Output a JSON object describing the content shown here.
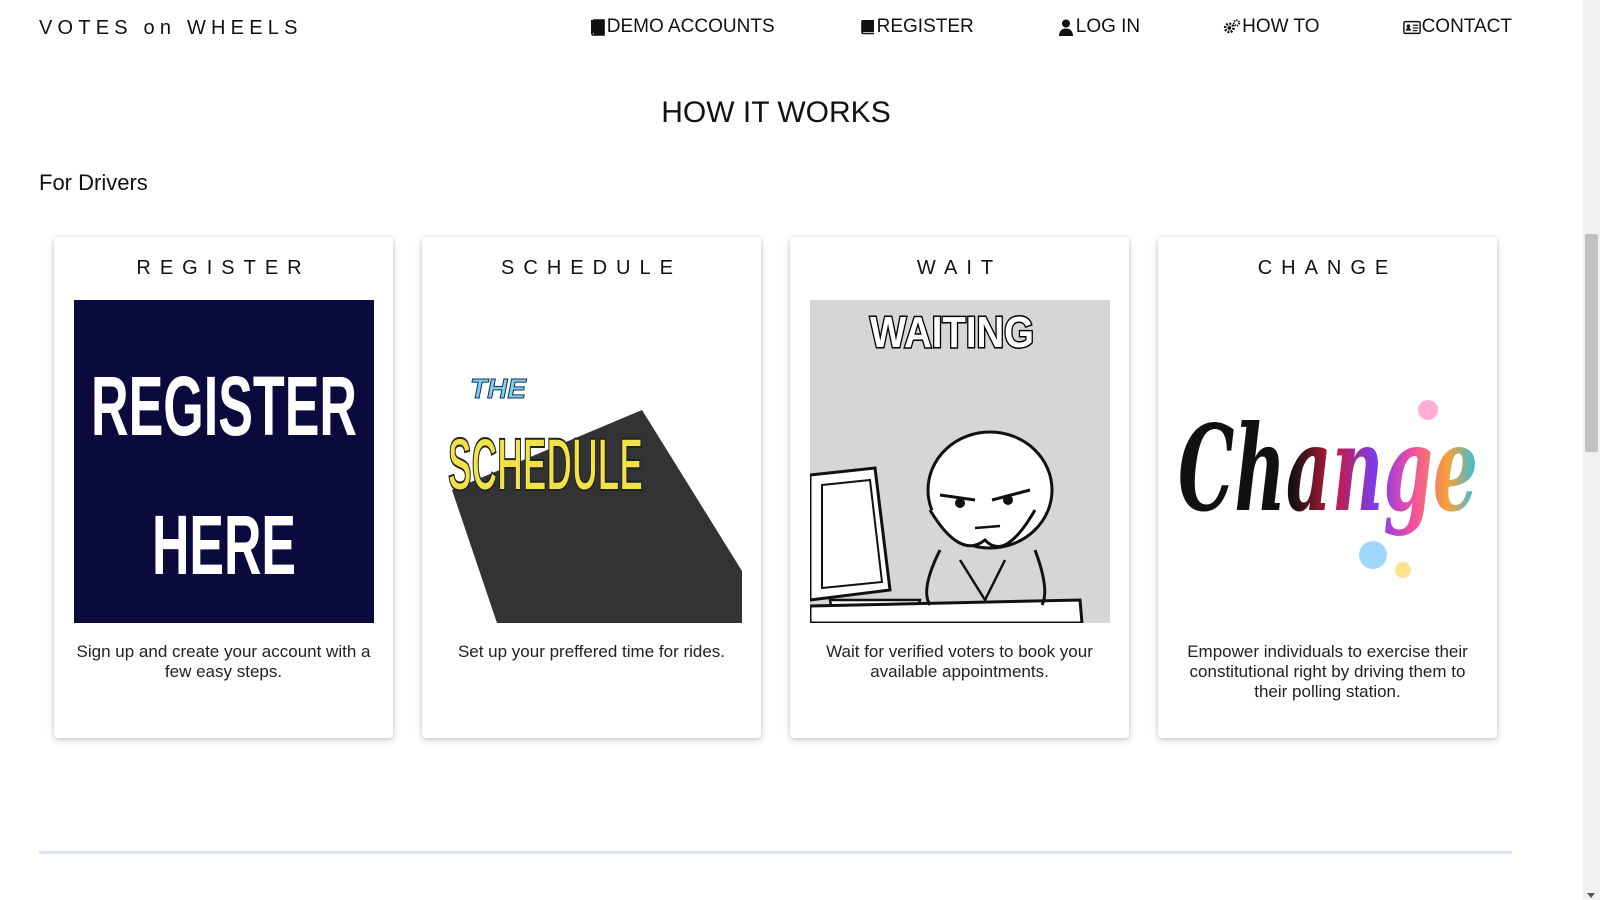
{
  "brand": "VOTES on WHEELS",
  "nav": [
    {
      "label": "DEMO ACCOUNTS",
      "icon": "book-icon"
    },
    {
      "label": "REGISTER",
      "icon": "book-icon"
    },
    {
      "label": "LOG IN",
      "icon": "user-icon"
    },
    {
      "label": "HOW TO",
      "icon": "gears-icon"
    },
    {
      "label": "CONTACT",
      "icon": "id-card-icon"
    }
  ],
  "page_title": "HOW IT WORKS",
  "section_title": "For Drivers",
  "cards": [
    {
      "title": "REGISTER",
      "image_text": [
        "REGISTER",
        "HERE"
      ],
      "description": "Sign up and create your account with a few easy steps."
    },
    {
      "title": "SCHEDULE",
      "image_text": [
        "THE",
        "SCHEDULE"
      ],
      "description": "Set up your preffered time for rides."
    },
    {
      "title": "WAIT",
      "image_text": [
        "WAITING"
      ],
      "description": "Wait for verified voters to book your available appointments."
    },
    {
      "title": "CHANGE",
      "image_text": [
        "Change"
      ],
      "description": "Empower individuals to exercise their constitutional right by driving them to their polling station."
    }
  ],
  "colors": {
    "register_bg": "#0a0a3c",
    "schedule_yellow": "#f2e24a",
    "wait_bg": "#d6d6d6",
    "divider": "#dde3f3"
  }
}
